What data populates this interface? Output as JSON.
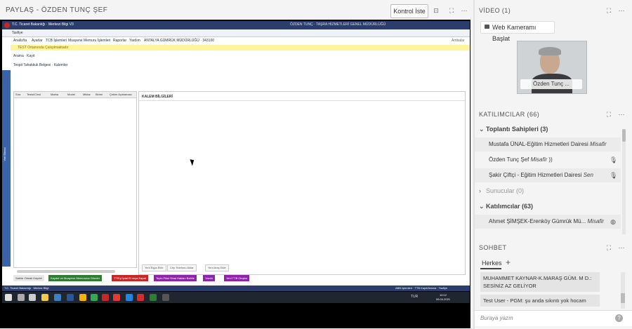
{
  "share": {
    "title": "PAYLAŞ - ÖZDEN TUNÇ ŞEF",
    "control_label": "Kontrol İste"
  },
  "remote": {
    "app_title": "T.C. Ticaret Bakanlığı · Merkezi Bilgi V3",
    "app_user": "ÖZDEN TUNÇ · TAŞRA HİZMETLERİ GENEL MÜDÜRLÜĞÜ",
    "tab": "Tasfiye",
    "menu": [
      "Analiz/ta",
      "Ayarlar",
      "TCB İşlemleri",
      "Muayene Memuru İşlemleri",
      "Raporlar",
      "Yardım",
      "ANTALYA GÜMRÜK MÜDÜRLÜĞÜ · 343100"
    ],
    "menu_right": "Ambalar",
    "warning": "TEST Ortamında Çalışılmaktadır",
    "subtabs": "Arama  ·  Kayıt",
    "subtabs2": "Tespit Tahakkuk Belgesi  ·  Kalemler",
    "left_strip": "Veri Ekranı",
    "grid_cols": [
      "Sıra",
      "Tesisi/Cinsi",
      "Marka",
      "Model",
      "Miktar",
      "Birimi",
      "Çekim Açıklaması"
    ],
    "kalem_title": "KALEM BİLGİLERİ",
    "right_btns": [
      "Yeni Eşya Ekle",
      "Cep Telefonu Aktar",
      "Yeni Araç Ekle"
    ],
    "bottom_btns": [
      {
        "label": "Satıldı Olarak Kaydet",
        "color": "#e8e8e8",
        "text": "#333"
      },
      {
        "label": "Kaydet ve Muayene Memuruna Gönder",
        "color": "#2e7d32",
        "text": "#fff"
      },
      {
        "label": "TTB'yi İptal Et veya Kapat",
        "color": "#c62828",
        "text": "#fff"
      },
      {
        "label": "Teplu Fiksi Sinai Hakları Belirle",
        "color": "#8e24aa",
        "text": "#fff"
      },
      {
        "label": "Yazdır",
        "color": "#8e24aa",
        "text": "#fff"
      },
      {
        "label": "Yeni TTB Oluştur",
        "color": "#8e24aa",
        "text": "#fff"
      }
    ],
    "status_left": "T.C. Ticaret Bakanlığı · Merkez Bilgi",
    "status_right": "ABB İşlemleri · TTB Kayıt/Arama · Tasfiye",
    "clock_time": "10:12",
    "clock_date": "06.04.2021",
    "tray": "TUR"
  },
  "video": {
    "title": "VİDEO (1)",
    "webcam_label": "Web Kameramı Başlat",
    "tile_name": "Özden Tunç ..."
  },
  "participants": {
    "title": "KATILIMCILAR (66)",
    "groups": {
      "hosts": "Toplantı Sahipleri (3)",
      "presenters": "Sunucular (0)",
      "attendees": "Katılımcılar (63)"
    },
    "hosts": [
      {
        "name": "Mustafa ÜNAL-Eğitim Hizmetleri Dairesi",
        "role": "Misafir",
        "icon": "none"
      },
      {
        "name": "Özden Tunç Şef",
        "role": "Misafir",
        "icon": "mic"
      },
      {
        "name": "Şakir Çiftçi - Eğitim Hizmetleri Dairesi",
        "role": "Sen",
        "icon": "mic-off"
      }
    ],
    "attendees": [
      {
        "name": "Ahmet ŞİMŞEK-Erenköy Gümrük Mü...",
        "role": "Misafir",
        "icon": "globe"
      }
    ]
  },
  "chat": {
    "title": "SOHBET",
    "tab_everyone": "Herkes",
    "messages": [
      {
        "text": "MUHAMMET KAYNAR-K.MARAŞ GÜM. M D.: SESİNİZ AZ GELİYOR"
      },
      {
        "text": "Test User - PGM: şu anda sıkıntı yok hocam"
      }
    ],
    "placeholder": "Buraya yazın"
  }
}
